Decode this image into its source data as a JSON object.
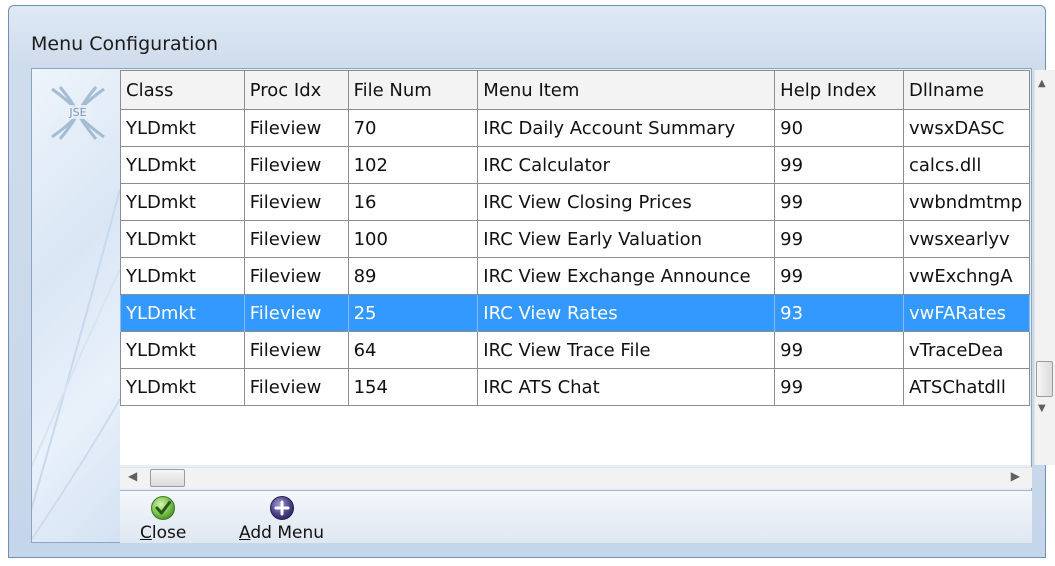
{
  "window": {
    "title": "Menu Configuration"
  },
  "logo": {
    "text": "JSE"
  },
  "grid": {
    "columns": [
      "Class",
      "Proc Idx",
      "File Num",
      "Menu Item",
      "Help Index",
      "Dllname"
    ],
    "rows": [
      [
        "YLDmkt",
        "Fileview",
        "70",
        "IRC Daily Account Summary",
        "90",
        "vwsxDASC"
      ],
      [
        "YLDmkt",
        "Fileview",
        "102",
        "IRC Calculator",
        "99",
        "calcs.dll"
      ],
      [
        "YLDmkt",
        "Fileview",
        "16",
        "IRC View Closing Prices",
        "99",
        "vwbndmtmp"
      ],
      [
        "YLDmkt",
        "Fileview",
        "100",
        "IRC View Early Valuation",
        "99",
        "vwsxearlyv"
      ],
      [
        "YLDmkt",
        "Fileview",
        "89",
        "IRC View Exchange Announce",
        "99",
        "vwExchngA"
      ],
      [
        "YLDmkt",
        "Fileview",
        "25",
        "IRC View Rates",
        "93",
        "vwFARates"
      ],
      [
        "YLDmkt",
        "Fileview",
        "64",
        "IRC View Trace File",
        "99",
        "vTraceDea"
      ],
      [
        "YLDmkt",
        "Fileview",
        "154",
        "IRC ATS Chat",
        "99",
        "ATSChatdll"
      ]
    ],
    "selected_row_index": 5,
    "selection_color": "#3399ff"
  },
  "toolbar": {
    "close": {
      "label": "Close",
      "mnemonic": "C",
      "icon": "checkmark-icon",
      "color": "#4aa02c"
    },
    "add_menu": {
      "label": "Add Menu",
      "mnemonic": "A",
      "icon": "plus-circle-icon",
      "color": "#3f3870"
    }
  }
}
